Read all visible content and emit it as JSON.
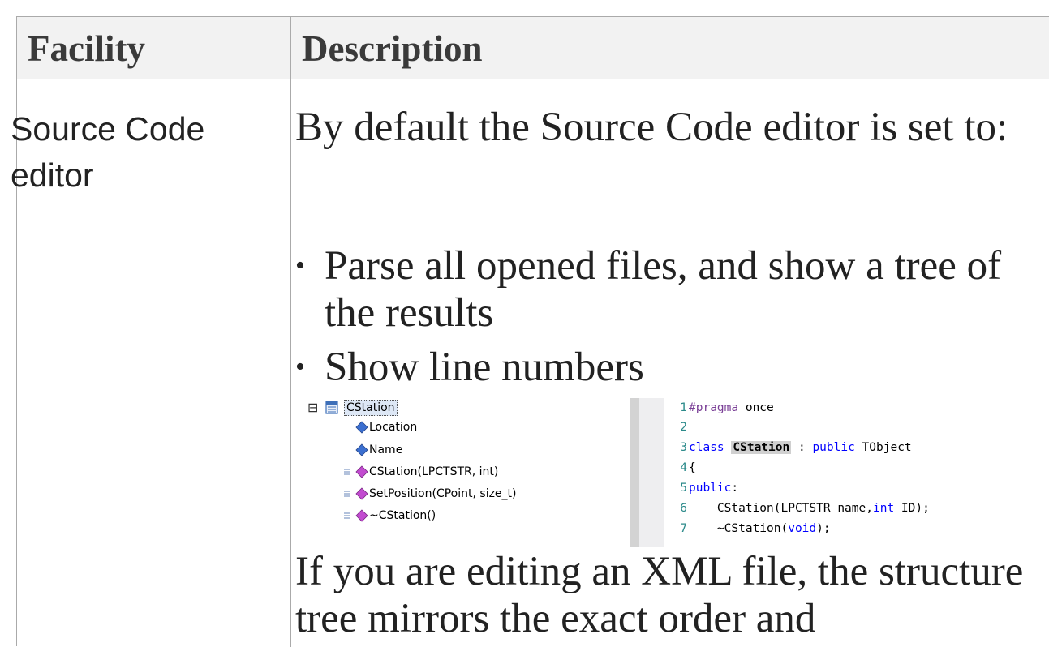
{
  "table": {
    "headers": {
      "facility": "Facility",
      "description": "Description"
    },
    "row": {
      "facility": "Source Code editor",
      "intro": "By default the Source Code editor is set to:",
      "bullets": [
        "Parse all opened files, and show a tree of the results",
        "Show line numbers"
      ],
      "xml_note": "If you are editing an XML file, the structure tree mirrors the exact order and"
    }
  },
  "screenshot": {
    "tree": {
      "collapse_glyph": "⊟",
      "root": "CStation",
      "members": [
        {
          "label": "Location",
          "icon": "attribute-icon"
        },
        {
          "label": "Name",
          "icon": "attribute-icon"
        },
        {
          "label": "CStation(LPCTSTR, int)",
          "icon": "operation-icon"
        },
        {
          "label": "SetPosition(CPoint, size_t)",
          "icon": "operation-icon"
        },
        {
          "label": "~CStation()",
          "icon": "operation-icon"
        }
      ]
    },
    "code": {
      "line_numbers": [
        "1",
        "2",
        "3",
        "4",
        "5",
        "6",
        "7"
      ],
      "l1_directive": "#pragma",
      "l1_rest": " once",
      "l3_class": "class",
      "l3_name": "CStation",
      "l3_colon": " : ",
      "l3_public": "public",
      "l3_base": " TObject",
      "l4": "{",
      "l5_public": "public",
      "l5_colon": ":",
      "l6_pre": "    CStation(LPCTSTR name,",
      "l6_int": "int",
      "l6_post": " ID);",
      "l7_pre": "    ~CStation(",
      "l7_void": "void",
      "l7_post": ");"
    },
    "colors": {
      "keyword": "#0000ff",
      "directive": "#7a3f96",
      "line_number": "#2b8a8a",
      "attribute_icon": "#3b6fd0",
      "operation_icon": "#c24bd0"
    }
  }
}
